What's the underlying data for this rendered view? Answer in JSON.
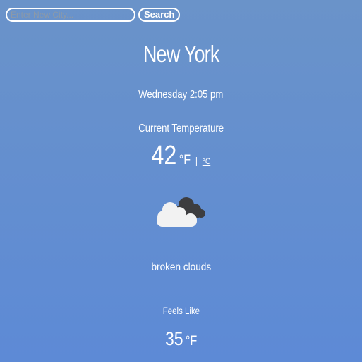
{
  "search": {
    "placeholder": "Enter New City...",
    "button_label": "Search"
  },
  "city": "New York",
  "datetime": "Wednesday 2:05 pm",
  "current": {
    "label": "Current Temperature",
    "value": "42",
    "unit_f": "°F",
    "separator": "|",
    "unit_c": "°C"
  },
  "weather": {
    "icon": "broken-clouds-icon",
    "description": "broken clouds"
  },
  "feels_like": {
    "label": "Feels Like",
    "value": "35",
    "unit": "°F"
  },
  "colors": {
    "background_top": "#6a93c9",
    "background_bottom": "#5d8ad6",
    "text": "#ffffff"
  }
}
